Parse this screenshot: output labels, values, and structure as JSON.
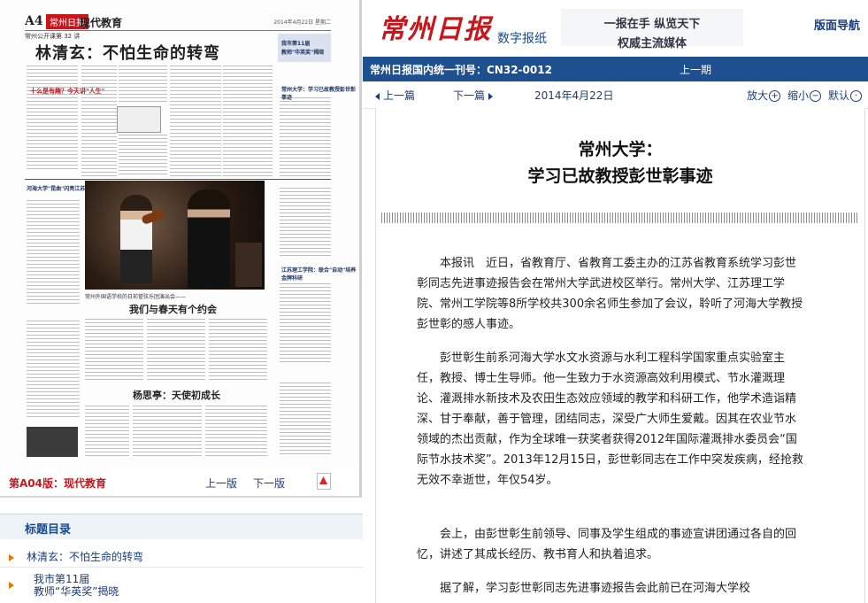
{
  "paper": {
    "page_no": "A4",
    "logo": "常州日报",
    "section": "现代教育",
    "header_date": "2014年4月22日 星期二",
    "subheader": "常州公开课第 32 讲",
    "headline": "林清玄：不怕生命的转弯",
    "side_tag": "我市第11届",
    "side_title": "教师\"华英奖\"揭晓",
    "side_title2": "常州大学：学习已故教授彭世彰事迹",
    "side_title3": "河海大学\"昆曲\"闪亮江苏高校舞台",
    "side_title4": "江苏理工学院：联合\"自动\"培养金牌科研",
    "red_text1": "十么是有趣？今天讲\"人生\"",
    "red_text2": "我们让一生做什么",
    "photo_caption": "常州外国语学校的日前管弦乐团演出会——",
    "h2": "我们与春天有个约会",
    "h3": "杨思亭：天使初成长"
  },
  "paper_footer": {
    "label": "第A04版：现代教育",
    "prev": "上一版",
    "next": "下一版"
  },
  "toc": {
    "heading": "标题目录",
    "items": [
      "林清玄：不怕生命的转弯",
      "我市第11届",
      "教师“华英奖”揭晓"
    ]
  },
  "header": {
    "logo": "常州日报",
    "digital": "数字报纸",
    "slogan1": "一报在手 纵览天下",
    "slogan2": "权威主流媒体",
    "nav": "版面导航"
  },
  "bluebar": {
    "text": "常州日报国内统一刊号：CN32-0012",
    "prev": "上一期"
  },
  "toolbar": {
    "prev": "上一篇",
    "next": "下一篇",
    "date": "2014年4月22日",
    "zoom_in": "放大",
    "zoom_out": "缩小",
    "default": "默认"
  },
  "article": {
    "title1": "常州大学：",
    "title2": "学习已故教授彭世彰事迹",
    "paragraphs": [
      "本报讯　近日，省教育厅、省教育工委主办的江苏省教育系统学习彭世彰同志先进事迹报告会在常州大学武进校区举行。常州大学、江苏理工学院、常州工学院等8所学校共300余名师生参加了会议，聆听了河海大学教授彭世彰的感人事迹。",
      "彭世彰生前系河海大学水文水资源与水利工程科学国家重点实验室主任，教授、博士生导师。他一生致力于水资源高效利用模式、节水灌溉理论、灌溉排水新技术及农田生态效应领域的教学和科研工作，他学术造诣精深、甘于奉献，善于管理，团结同志，深受广大师生爱戴。因其在农业节水领域的杰出贡献，作为全球唯一获奖者获得2012年国际灌溉排水委员会“国际节水技术奖”。2013年12月15日，彭世彰同志在工作中突发疾病，经抢救无效不幸逝世，年仅54岁。",
      "会上，由彭世彰生前领导、同事及学生组成的事迹宣讲团通过各自的回忆，讲述了其成长经历、教书育人和执着追求。",
      "据了解，学习彭世彰同志先进事迹报告会此前已在河海大学校"
    ]
  },
  "colors": {
    "brand_red": "#c8161d",
    "nav_blue": "#1e4f8e",
    "link_blue": "#1a3d7a",
    "accent_orange": "#e07a00"
  }
}
